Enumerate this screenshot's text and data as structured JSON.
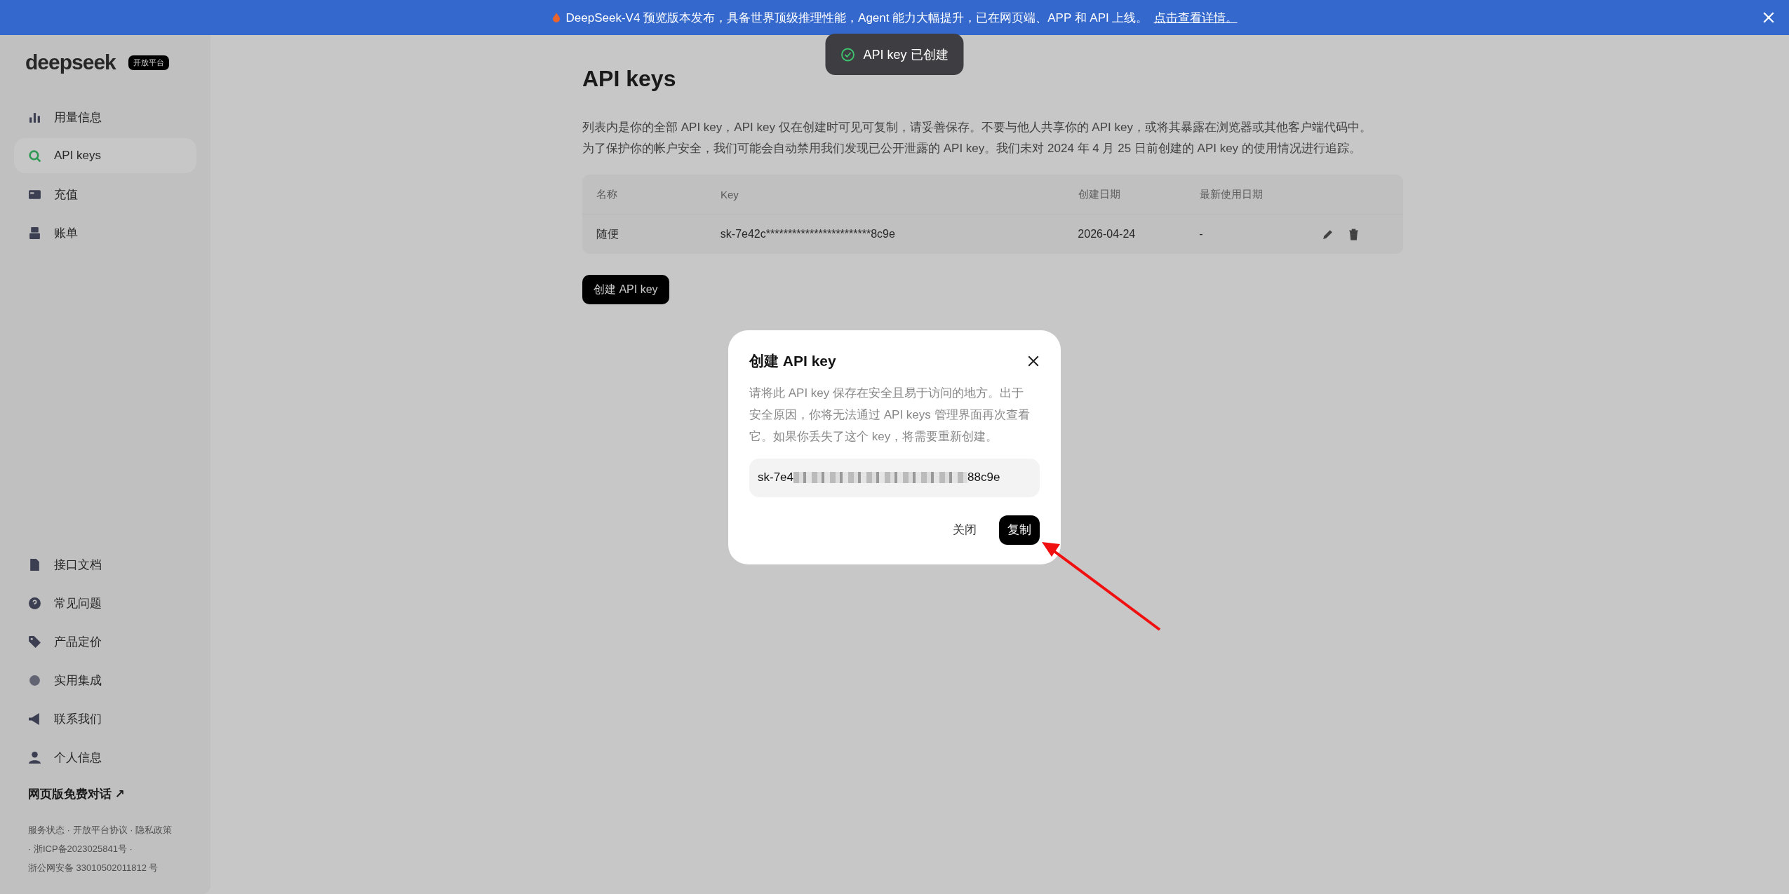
{
  "banner": {
    "text": "DeepSeek-V4 预览版本发布，具备世界顶级推理性能，Agent 能力大幅提升，已在网页端、APP 和 API 上线。",
    "link": "点击查看详情。"
  },
  "toast": {
    "text": "API key 已创建"
  },
  "sidebar": {
    "logo": "deepseek",
    "badge": "开放平台",
    "items": [
      {
        "label": "用量信息",
        "selected": false
      },
      {
        "label": "API keys",
        "selected": true
      },
      {
        "label": "充值",
        "selected": false
      },
      {
        "label": "账单",
        "selected": false
      }
    ],
    "bottom_items": [
      {
        "label": "接口文档"
      },
      {
        "label": "常见问题"
      },
      {
        "label": "产品定价"
      },
      {
        "label": "实用集成"
      },
      {
        "label": "联系我们"
      },
      {
        "label": "个人信息"
      }
    ],
    "chat_link": "网页版免费对话 ↗",
    "footer": [
      "服务状态 · 开放平台协议 · 隐私政策",
      "· 浙ICP备2023025841号 ·",
      "浙公网安备 33010502011812 号"
    ]
  },
  "page": {
    "title": "API keys",
    "description": [
      "列表内是你的全部 API key，API key 仅在创建时可见可复制，请妥善保存。不要与他人共享你的 API key，或将其暴露在浏览器或其他客户端代码中。",
      "为了保护你的帐户安全，我们可能会自动禁用我们发现已公开泄露的 API key。我们未对 2024 年 4 月 25 日前创建的 API key 的使用情况进行追踪。"
    ],
    "table": {
      "columns": [
        "名称",
        "Key",
        "创建日期",
        "最新使用日期"
      ],
      "rows": [
        {
          "name": "随便",
          "key": "sk-7e42c************************8c9e",
          "created": "2026-04-24",
          "last_used": "-"
        }
      ]
    },
    "create_button": "创建 API key"
  },
  "dialog": {
    "title": "创建 API key",
    "message": "请将此 API key 保存在安全且易于访问的地方。出于安全原因，你将无法通过 API keys 管理界面再次查看它。如果你丢失了这个 key，将需要重新创建。",
    "key_start": "sk-7e4",
    "key_end": "88c9e",
    "buttons": [
      {
        "label": "关闭",
        "kind": "text"
      },
      {
        "label": "复制",
        "kind": "primary"
      }
    ]
  }
}
